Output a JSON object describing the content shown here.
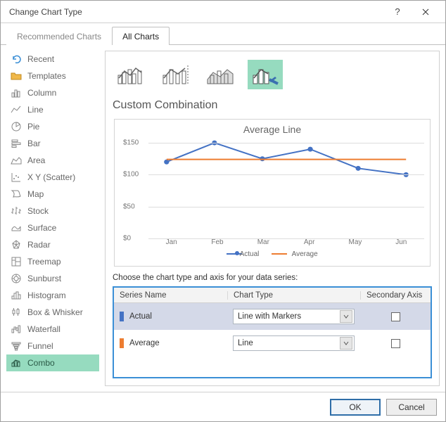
{
  "window": {
    "title": "Change Chart Type"
  },
  "tabs": {
    "recommended": "Recommended Charts",
    "all": "All Charts"
  },
  "sidebar": {
    "items": [
      {
        "label": "Recent"
      },
      {
        "label": "Templates"
      },
      {
        "label": "Column"
      },
      {
        "label": "Line"
      },
      {
        "label": "Pie"
      },
      {
        "label": "Bar"
      },
      {
        "label": "Area"
      },
      {
        "label": "X Y (Scatter)"
      },
      {
        "label": "Map"
      },
      {
        "label": "Stock"
      },
      {
        "label": "Surface"
      },
      {
        "label": "Radar"
      },
      {
        "label": "Treemap"
      },
      {
        "label": "Sunburst"
      },
      {
        "label": "Histogram"
      },
      {
        "label": "Box & Whisker"
      },
      {
        "label": "Waterfall"
      },
      {
        "label": "Funnel"
      },
      {
        "label": "Combo"
      }
    ]
  },
  "section_title": "Custom Combination",
  "choose_label": "Choose the chart type and axis for your data series:",
  "headers": {
    "series_name": "Series Name",
    "chart_type": "Chart Type",
    "secondary": "Secondary Axis"
  },
  "series": [
    {
      "name": "Actual",
      "chart_type": "Line with Markers",
      "secondary": false,
      "color": "#4472C4"
    },
    {
      "name": "Average",
      "chart_type": "Line",
      "secondary": false,
      "color": "#ED7D31"
    }
  ],
  "buttons": {
    "ok": "OK",
    "cancel": "Cancel"
  },
  "chart_data": {
    "type": "line",
    "title": "Average Line",
    "categories": [
      "Jan",
      "Feb",
      "Mar",
      "Apr",
      "May",
      "Jun"
    ],
    "series": [
      {
        "name": "Actual",
        "values": [
          120,
          150,
          125,
          140,
          110,
          100
        ],
        "color": "#4472C4",
        "markers": true
      },
      {
        "name": "Average",
        "values": [
          124,
          124,
          124,
          124,
          124,
          124
        ],
        "color": "#ED7D31",
        "markers": false
      }
    ],
    "y_ticks": [
      0,
      50,
      100,
      150
    ],
    "y_tick_labels": [
      "$0",
      "$50",
      "$100",
      "$150"
    ],
    "ylim": [
      0,
      160
    ],
    "legend": [
      "Actual",
      "Average"
    ]
  }
}
